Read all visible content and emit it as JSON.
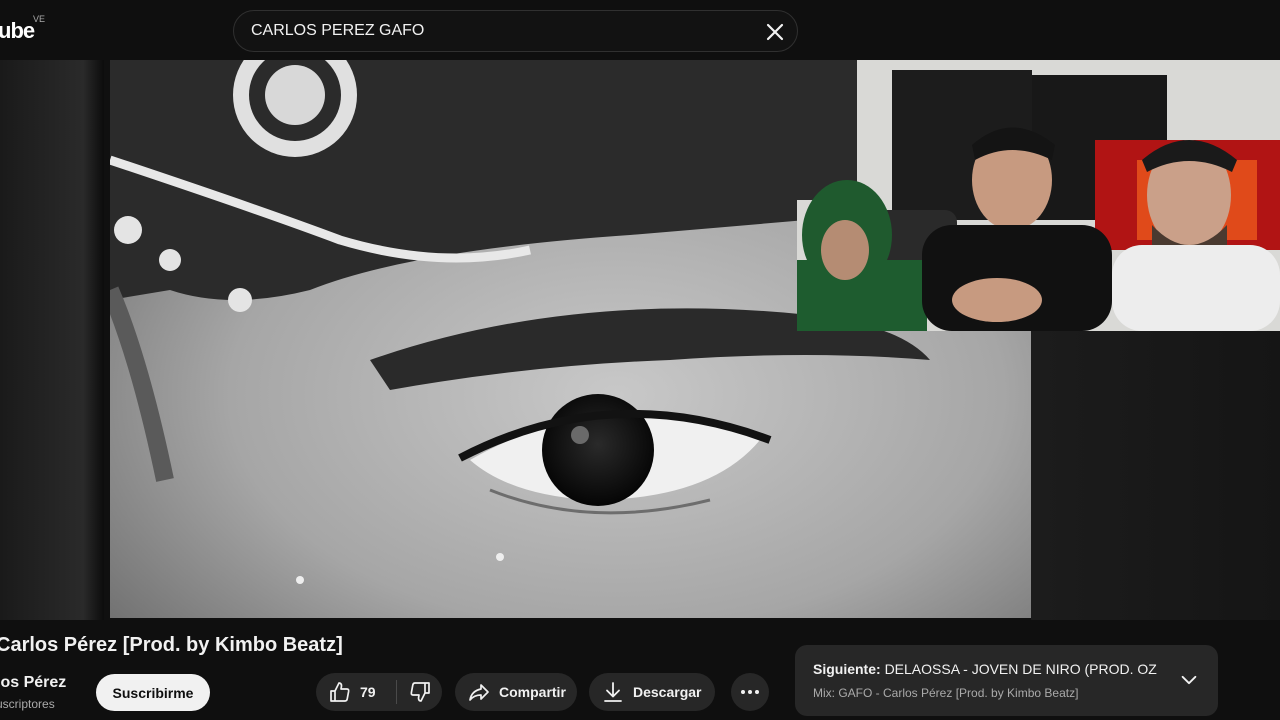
{
  "header": {
    "logo_text": "ube",
    "region": "VE",
    "search_value": "CARLOS PEREZ GAFO"
  },
  "video": {
    "title": "Carlos Pérez [Prod. by Kimbo Beatz]",
    "channel_name": "los Pérez",
    "subscribers": "uscriptores",
    "subscribe_label": "Suscribirme",
    "like_count": "79",
    "share_label": "Compartir",
    "download_label": "Descargar"
  },
  "up_next": {
    "label": "Siguiente:",
    "title": "DELAOSSA - JOVEN DE NIRO (PROD. OZ...",
    "mix": "Mix: GAFO - Carlos Pérez [Prod. by Kimbo Beatz]"
  },
  "colors": {
    "background": "#0f0f0f",
    "pill": "#272727",
    "subscribe_bg": "#f1f1f1"
  },
  "icons": [
    "close-icon",
    "like-icon",
    "dislike-icon",
    "share-icon",
    "download-icon",
    "more-icon",
    "chevron-down-icon"
  ]
}
